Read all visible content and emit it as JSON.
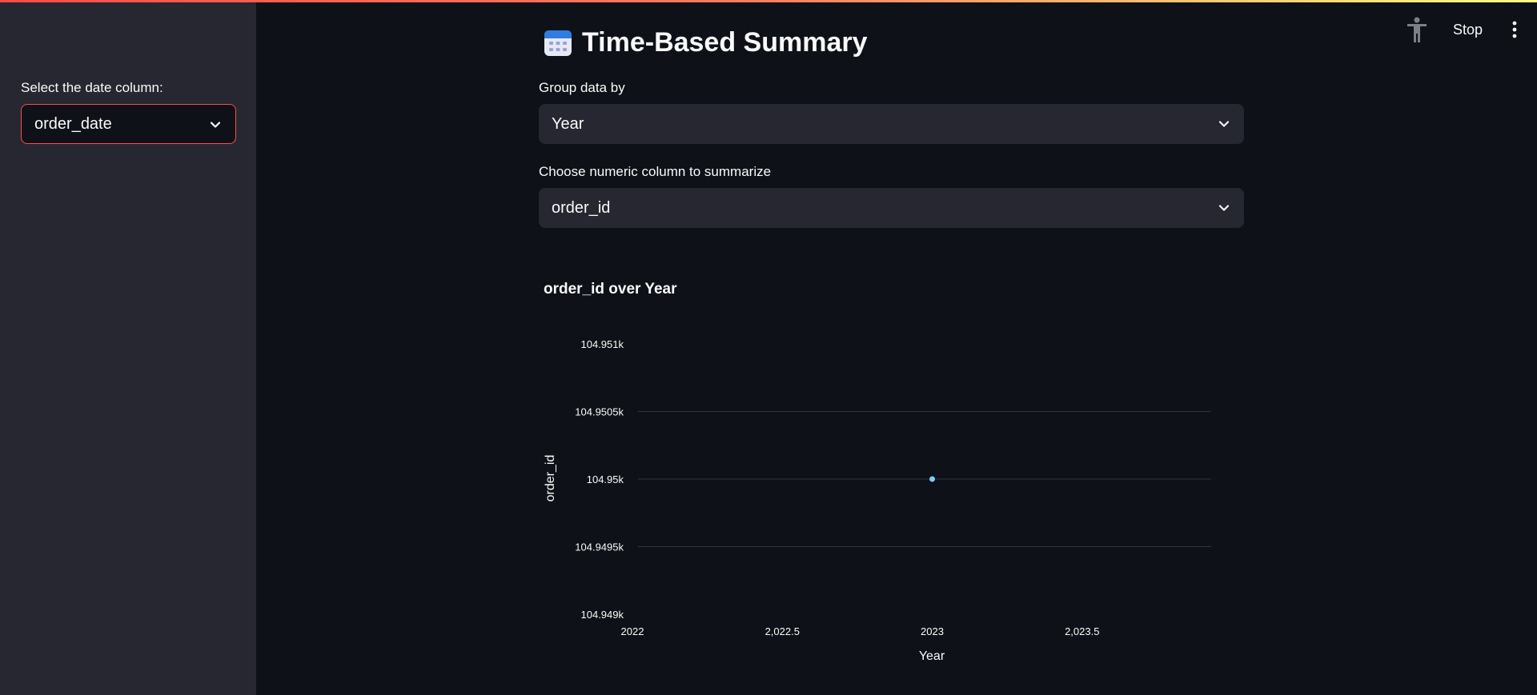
{
  "sidebar": {
    "date_label": "Select the date column:",
    "date_value": "order_date"
  },
  "header": {
    "stop_label": "Stop",
    "accessibility_icon": "accessibility-icon",
    "menu_icon": "kebab-menu-icon"
  },
  "main": {
    "title": "Time-Based Summary",
    "title_icon": "calendar-icon",
    "group_label": "Group data by",
    "group_value": "Year",
    "numeric_label": "Choose numeric column to summarize",
    "numeric_value": "order_id"
  },
  "colors": {
    "accent": "#ff4b4b",
    "point": "#83c9ff",
    "background": "#0e1117",
    "sidebar": "#262730"
  },
  "chart_data": {
    "type": "scatter",
    "title": "order_id over Year",
    "xlabel": "Year",
    "ylabel": "order_id",
    "x_ticks": [
      "2022",
      "2,022.5",
      "2023",
      "2,023.5"
    ],
    "y_ticks": [
      "104.951k",
      "104.9505k",
      "104.95k",
      "104.9495k",
      "104.949k"
    ],
    "xlim": [
      2022,
      2024
    ],
    "ylim": [
      104949,
      104951
    ],
    "grid": true,
    "series": [
      {
        "x": [
          2023
        ],
        "y": [
          104950
        ]
      }
    ]
  }
}
